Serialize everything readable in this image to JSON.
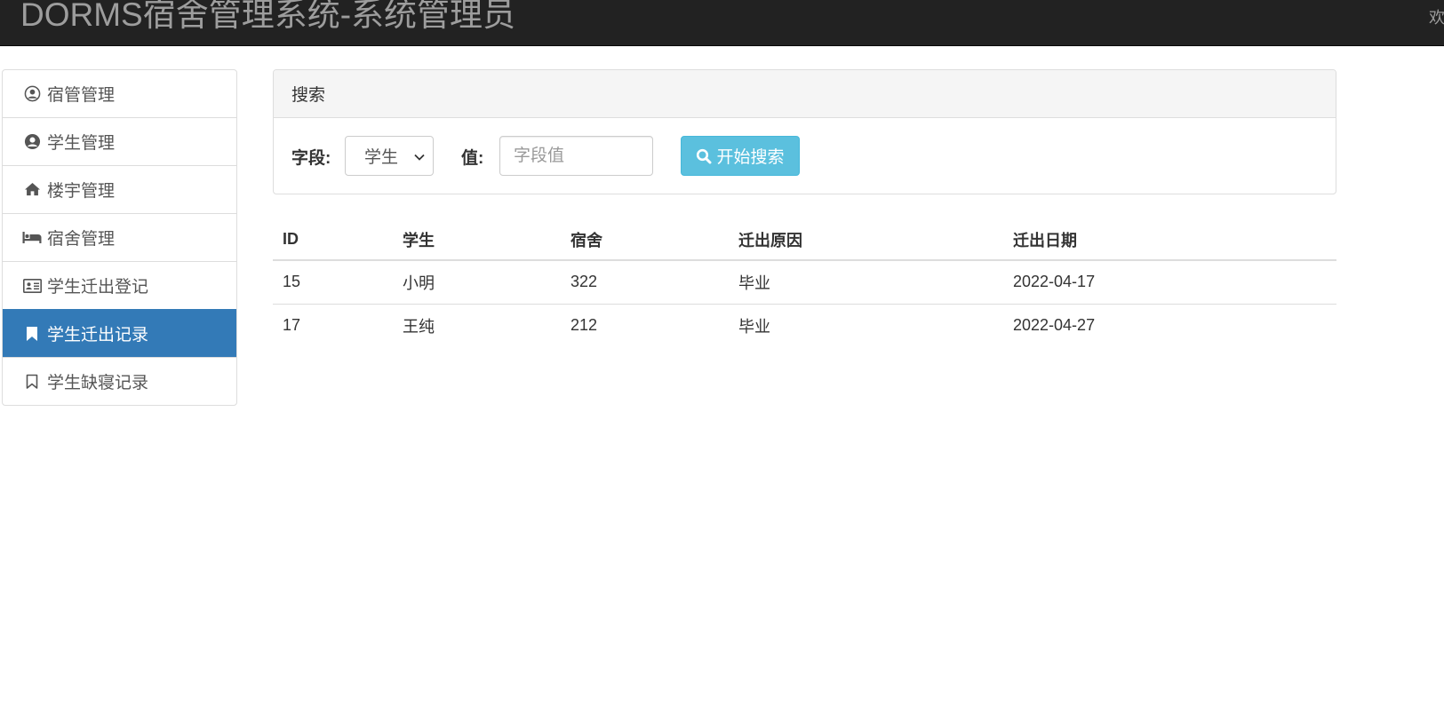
{
  "navbar": {
    "brand": "DORMS宿舍管理系统-系统管理员",
    "welcome": "欢"
  },
  "sidebar": {
    "items": [
      {
        "label": "宿管管理",
        "icon": "user-circle-icon",
        "active": false
      },
      {
        "label": "学生管理",
        "icon": "user-circle-solid-icon",
        "active": false
      },
      {
        "label": "楼宇管理",
        "icon": "home-icon",
        "active": false
      },
      {
        "label": "宿舍管理",
        "icon": "bed-icon",
        "active": false
      },
      {
        "label": "学生迁出登记",
        "icon": "id-card-icon",
        "active": false
      },
      {
        "label": "学生迁出记录",
        "icon": "bookmark-icon",
        "active": true
      },
      {
        "label": "学生缺寝记录",
        "icon": "bookmark-outline-icon",
        "active": false
      }
    ]
  },
  "search": {
    "heading": "搜索",
    "field_label": "字段:",
    "field_selected": "学生",
    "value_label": "值:",
    "value_placeholder": "字段值",
    "button_label": "开始搜索"
  },
  "table": {
    "headers": [
      "ID",
      "学生",
      "宿舍",
      "迁出原因",
      "迁出日期"
    ],
    "rows": [
      [
        "15",
        "小明",
        "322",
        "毕业",
        "2022-04-17"
      ],
      [
        "17",
        "王纯",
        "212",
        "毕业",
        "2022-04-27"
      ]
    ]
  },
  "colors": {
    "navbar_bg": "#222222",
    "active_item": "#337ab7",
    "search_button": "#5bc0de"
  }
}
